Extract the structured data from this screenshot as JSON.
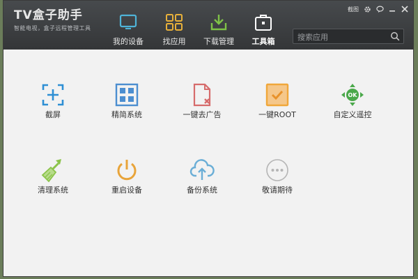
{
  "app": {
    "title": "TV盒子助手",
    "subtitle": "智能电视，盒子远程管理工具"
  },
  "nav": [
    {
      "label": "我的设备",
      "icon": "monitor-icon",
      "color": "#4fb4d8"
    },
    {
      "label": "找应用",
      "icon": "grid-icon",
      "color": "#e8b13a"
    },
    {
      "label": "下载管理",
      "icon": "download-icon",
      "color": "#7fc247"
    },
    {
      "label": "工具箱",
      "icon": "toolbox-icon",
      "color": "#ffffff",
      "active": true
    }
  ],
  "controls": {
    "screenshot_label": "截图"
  },
  "search": {
    "placeholder": "搜索应用"
  },
  "tools": [
    {
      "label": "截屏",
      "icon": "screenshot-icon",
      "color": "#2e8fd4"
    },
    {
      "label": "精简系统",
      "icon": "grid-icon",
      "color": "#4c8ed0"
    },
    {
      "label": "一键去广告",
      "icon": "ad-remove-icon",
      "color": "#d66b6b"
    },
    {
      "label": "一键ROOT",
      "icon": "root-icon",
      "color": "#f0a73a"
    },
    {
      "label": "自定义遥控",
      "icon": "remote-control-icon",
      "color": "#4aa84a"
    },
    {
      "label": "清理系统",
      "icon": "broom-icon",
      "color": "#8bc34a"
    },
    {
      "label": "重启设备",
      "icon": "power-icon",
      "color": "#e8a43a"
    },
    {
      "label": "备份系统",
      "icon": "cloud-upload-icon",
      "color": "#6aaed6"
    },
    {
      "label": "敬请期待",
      "icon": "more-icon",
      "color": "#b5b5b5"
    }
  ]
}
